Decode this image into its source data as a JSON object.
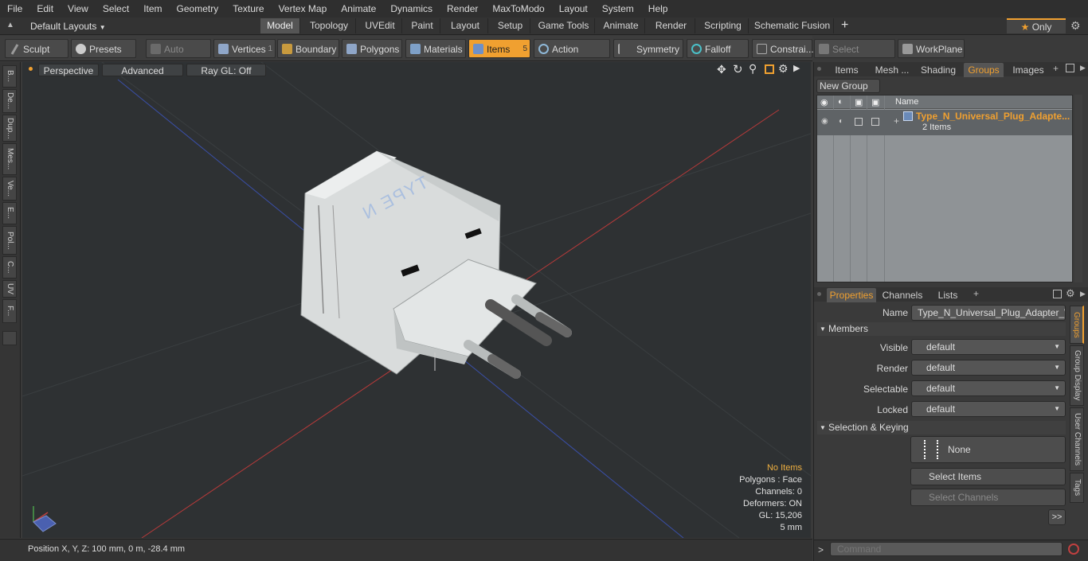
{
  "menu": [
    "File",
    "Edit",
    "View",
    "Select",
    "Item",
    "Geometry",
    "Texture",
    "Vertex Map",
    "Animate",
    "Dynamics",
    "Render",
    "MaxToModo",
    "Layout",
    "System",
    "Help"
  ],
  "layout_selector": "Default Layouts",
  "layout_tabs": [
    "Model",
    "Topology",
    "UVEdit",
    "Paint",
    "Layout",
    "Setup",
    "Game Tools",
    "Animate",
    "Render",
    "Scripting",
    "Schematic Fusion"
  ],
  "only_label": "Only",
  "toolbar": {
    "sculpt": "Sculpt",
    "presets": "Presets",
    "auto_select": "Auto Select",
    "vertices": "Vertices",
    "vertices_count": "1",
    "boundary": "Boundary",
    "polygons": "Polygons",
    "materials": "Materials",
    "items": "Items",
    "items_count": "5",
    "action_center": "Action Center",
    "symmetry": "Symmetry",
    "falloff": "Falloff",
    "constraints": "Constrai...",
    "select_through": "Select Through",
    "workplane": "WorkPlane"
  },
  "left_tabs": [
    "B...",
    "De...",
    "Dup...",
    "Mes...",
    "Ve...",
    "E...",
    "Pol...",
    "C...",
    "UV",
    "F..."
  ],
  "viewport": {
    "view_mode": "Perspective",
    "shading": "Advanced",
    "raygl": "Ray GL: Off",
    "model_text": "TYPE N",
    "hud": {
      "items": "No Items",
      "polygons": "Polygons : Face",
      "channels": "Channels: 0",
      "deformers": "Deformers: ON",
      "gl": "GL: 15,206",
      "scale": "5 mm"
    }
  },
  "status": {
    "position": "Position X, Y, Z:   100 mm, 0 m, -28.4 mm"
  },
  "top_panel": {
    "tabs": [
      "Items",
      "Mesh ...",
      "Shading",
      "Groups",
      "Images"
    ],
    "active_tab": "Groups",
    "new_group": "New Group",
    "col_name": "Name",
    "group_name": "Type_N_Universal_Plug_Adapte...",
    "group_count": "2 Items"
  },
  "properties": {
    "tabs": [
      "Properties",
      "Channels",
      "Lists"
    ],
    "name_label": "Name",
    "name_value": "Type_N_Universal_Plug_Adapter_Whi",
    "members_title": "Members",
    "rows": [
      {
        "label": "Visible",
        "value": "default"
      },
      {
        "label": "Render",
        "value": "default"
      },
      {
        "label": "Selectable",
        "value": "default"
      },
      {
        "label": "Locked",
        "value": "default"
      }
    ],
    "sel_title": "Selection & Keying",
    "none_label": "None",
    "select_items": "Select Items",
    "select_channels": "Select Channels",
    "more": ">>",
    "side_tabs": [
      "Groups",
      "Group Display",
      "User Channels",
      "Tags"
    ]
  },
  "command_placeholder": "Command",
  "colors": {
    "accent": "#f0a030",
    "viewport_bg": "#2e3133",
    "axis_red": "#b83a3a",
    "axis_blue": "#3a4fa8"
  }
}
